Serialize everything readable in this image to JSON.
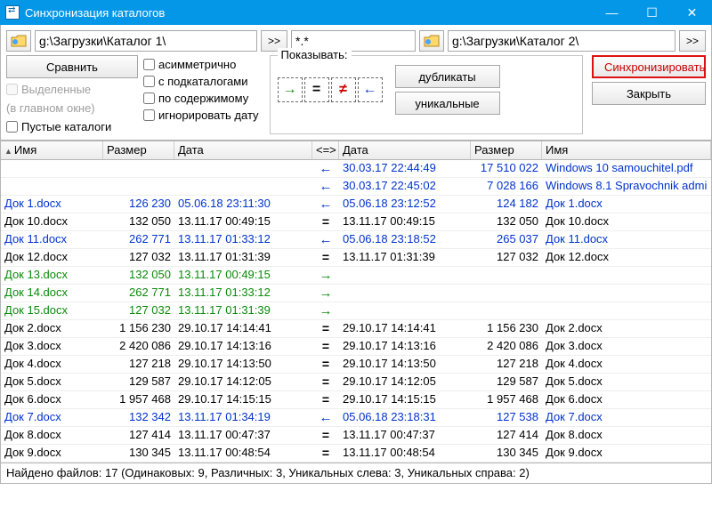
{
  "window": {
    "title": "Синхронизация каталогов"
  },
  "paths": {
    "left": "g:\\Загрузки\\Каталог 1\\",
    "right": "g:\\Загрузки\\Каталог 2\\",
    "filter": "*.*",
    "go": ">>"
  },
  "buttons": {
    "compare": "Сравнить",
    "sync": "Синхронизировать",
    "close": "Закрыть",
    "duplicates": "дубликаты",
    "unique": "уникальные"
  },
  "checks": {
    "asymmetric": "асимметрично",
    "subdirs": "с подкаталогами",
    "selected": "Выделенные",
    "selected_hint": "(в главном окне)",
    "bycontent": "по содержимому",
    "empty": "Пустые каталоги",
    "ignoredate": "игнорировать дату"
  },
  "show_label": "Показывать:",
  "headers": {
    "name_l": "Имя",
    "size_l": "Размер",
    "date_l": "Дата",
    "op": "<=>",
    "date_r": "Дата",
    "size_r": "Размер",
    "name_r": "Имя"
  },
  "rows": [
    {
      "n1": "",
      "s1": "",
      "d1": "",
      "op": "left",
      "d2": "30.03.17 22:44:49",
      "s2": "17 510 022",
      "n2": "Windows 10 samouchitel.pdf",
      "cls": "blue"
    },
    {
      "n1": "",
      "s1": "",
      "d1": "",
      "op": "left",
      "d2": "30.03.17 22:45:02",
      "s2": "7 028 166",
      "n2": "Windows 8.1 Spravochnik admi",
      "cls": "blue"
    },
    {
      "n1": "Док 1.docx",
      "s1": "126 230",
      "d1": "05.06.18 23:11:30",
      "op": "left",
      "d2": "05.06.18 23:12:52",
      "s2": "124 182",
      "n2": "Док 1.docx",
      "cls": "blue"
    },
    {
      "n1": "Док 10.docx",
      "s1": "132 050",
      "d1": "13.11.17 00:49:15",
      "op": "eq",
      "d2": "13.11.17 00:49:15",
      "s2": "132 050",
      "n2": "Док 10.docx",
      "cls": "black"
    },
    {
      "n1": "Док 11.docx",
      "s1": "262 771",
      "d1": "13.11.17 01:33:12",
      "op": "left",
      "d2": "05.06.18 23:18:52",
      "s2": "265 037",
      "n2": "Док 11.docx",
      "cls": "blue"
    },
    {
      "n1": "Док 12.docx",
      "s1": "127 032",
      "d1": "13.11.17 01:31:39",
      "op": "eq",
      "d2": "13.11.17 01:31:39",
      "s2": "127 032",
      "n2": "Док 12.docx",
      "cls": "black"
    },
    {
      "n1": "Док 13.docx",
      "s1": "132 050",
      "d1": "13.11.17 00:49:15",
      "op": "right",
      "d2": "",
      "s2": "",
      "n2": "",
      "cls": "green"
    },
    {
      "n1": "Док 14.docx",
      "s1": "262 771",
      "d1": "13.11.17 01:33:12",
      "op": "right",
      "d2": "",
      "s2": "",
      "n2": "",
      "cls": "green"
    },
    {
      "n1": "Док 15.docx",
      "s1": "127 032",
      "d1": "13.11.17 01:31:39",
      "op": "right",
      "d2": "",
      "s2": "",
      "n2": "",
      "cls": "green"
    },
    {
      "n1": "Док 2.docx",
      "s1": "1 156 230",
      "d1": "29.10.17 14:14:41",
      "op": "eq",
      "d2": "29.10.17 14:14:41",
      "s2": "1 156 230",
      "n2": "Док 2.docx",
      "cls": "black"
    },
    {
      "n1": "Док 3.docx",
      "s1": "2 420 086",
      "d1": "29.10.17 14:13:16",
      "op": "eq",
      "d2": "29.10.17 14:13:16",
      "s2": "2 420 086",
      "n2": "Док 3.docx",
      "cls": "black"
    },
    {
      "n1": "Док 4.docx",
      "s1": "127 218",
      "d1": "29.10.17 14:13:50",
      "op": "eq",
      "d2": "29.10.17 14:13:50",
      "s2": "127 218",
      "n2": "Док 4.docx",
      "cls": "black"
    },
    {
      "n1": "Док 5.docx",
      "s1": "129 587",
      "d1": "29.10.17 14:12:05",
      "op": "eq",
      "d2": "29.10.17 14:12:05",
      "s2": "129 587",
      "n2": "Док 5.docx",
      "cls": "black"
    },
    {
      "n1": "Док 6.docx",
      "s1": "1 957 468",
      "d1": "29.10.17 14:15:15",
      "op": "eq",
      "d2": "29.10.17 14:15:15",
      "s2": "1 957 468",
      "n2": "Док 6.docx",
      "cls": "black"
    },
    {
      "n1": "Док 7.docx",
      "s1": "132 342",
      "d1": "13.11.17 01:34:19",
      "op": "left",
      "d2": "05.06.18 23:18:31",
      "s2": "127 538",
      "n2": "Док 7.docx",
      "cls": "blue"
    },
    {
      "n1": "Док 8.docx",
      "s1": "127 414",
      "d1": "13.11.17 00:47:37",
      "op": "eq",
      "d2": "13.11.17 00:47:37",
      "s2": "127 414",
      "n2": "Док 8.docx",
      "cls": "black"
    },
    {
      "n1": "Док 9.docx",
      "s1": "130 345",
      "d1": "13.11.17 00:48:54",
      "op": "eq",
      "d2": "13.11.17 00:48:54",
      "s2": "130 345",
      "n2": "Док 9.docx",
      "cls": "black"
    }
  ],
  "status": "Найдено файлов: 17  (Одинаковых: 9, Различных: 3, Уникальных слева: 3, Уникальных справа: 2)"
}
